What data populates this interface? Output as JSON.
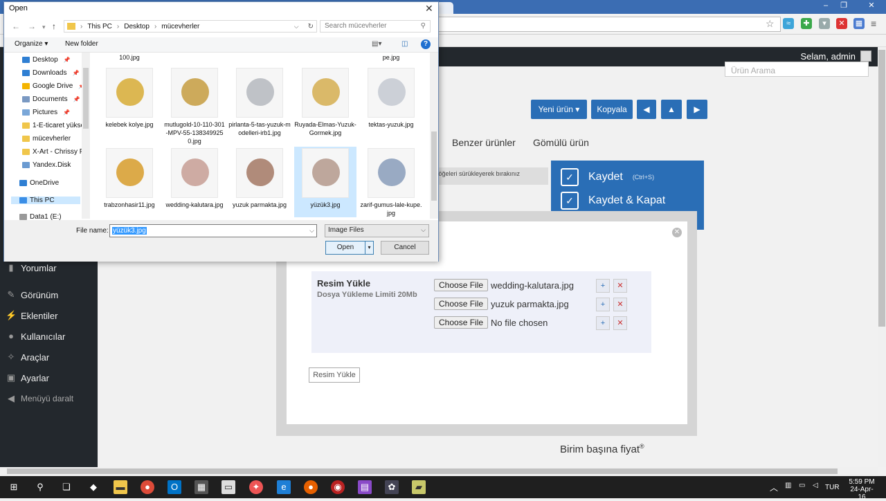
{
  "browser": {
    "minimize": "–",
    "restore": "❐",
    "close": "✕"
  },
  "wp": {
    "greeting": "Selam, admin",
    "search_placeholder": "Ürün Arama",
    "sidebar": [
      {
        "label": "Yorumlar",
        "icon": "comment-icon"
      },
      {
        "label": "Görünüm",
        "icon": "brush-icon"
      },
      {
        "label": "Eklentiler",
        "icon": "plugin-icon"
      },
      {
        "label": "Kullanıcılar",
        "icon": "user-icon"
      },
      {
        "label": "Araçlar",
        "icon": "wrench-icon"
      },
      {
        "label": "Ayarlar",
        "icon": "settings-icon"
      },
      {
        "label": "Menüyü daralt",
        "icon": "collapse-icon"
      }
    ],
    "buttons": {
      "new_product": "Yeni ürün",
      "copy": "Kopyala"
    },
    "tabs": [
      "Benzer ürünler",
      "Gömülü ürün"
    ],
    "hint": "n öğeleri sürükleyerek bırakınız",
    "save": "Kaydet",
    "save_shortcut": "(Ctrl+S)",
    "save_close": "Kaydet & Kapat",
    "unit_price": "Birim başına fiyat"
  },
  "modal": {
    "title": "Resim Yükle",
    "limit": "Dosya Yükleme Limiti 20Mb",
    "choose_label": "Choose File",
    "files": [
      "wedding-kalutara.jpg",
      "yuzuk parmakta.jpg",
      "No file chosen"
    ],
    "upload_button": "Resim Yükle"
  },
  "dialog": {
    "title": "Open",
    "breadcrumb": [
      "This PC",
      "Desktop",
      "mücevherler"
    ],
    "search_placeholder": "Search mücevherler",
    "organize": "Organize ▾",
    "new_folder": "New folder",
    "nav": [
      {
        "label": "Desktop",
        "color": "#2f7fd3",
        "pin": true
      },
      {
        "label": "Downloads",
        "color": "#2f7fd3",
        "pin": true
      },
      {
        "label": "Google Drive",
        "color": "#f4b400",
        "pin": true
      },
      {
        "label": "Documents",
        "color": "#7a99c2",
        "pin": true
      },
      {
        "label": "Pictures",
        "color": "#7aa7d8",
        "pin": true
      },
      {
        "label": "1-E-ticaret yükse",
        "color": "#f0c64b",
        "pin": false
      },
      {
        "label": "mücevherler",
        "color": "#f0c64b",
        "pin": false
      },
      {
        "label": "X-Art - Chrissy F",
        "color": "#f0c64b",
        "pin": false
      },
      {
        "label": "Yandex.Disk",
        "color": "#6b9bd1",
        "pin": false
      },
      {
        "label": "OneDrive",
        "color": "#2f7fd3",
        "pin": false
      },
      {
        "label": "This PC",
        "color": "#3a8ee6",
        "pin": false
      },
      {
        "label": "Data1 (E:)",
        "color": "#999999",
        "pin": false
      }
    ],
    "top_row": [
      "100.jpg",
      "pe.jpg"
    ],
    "files": [
      {
        "name": "kelebek kolye.jpg",
        "color": "#d9b040"
      },
      {
        "name": "mutlugold-10-110-301-MPV-55-1383499250.jpg",
        "color": "#c9a24a"
      },
      {
        "name": "pirlanta-5-tas-yuzuk-modelleri-irb1.jpg",
        "color": "#b9bcc2"
      },
      {
        "name": "Ruyada-Elmas-Yuzuk-Gormek.jpg",
        "color": "#d7b35a"
      },
      {
        "name": "tektas-yuzuk.jpg",
        "color": "#c8ccd4"
      },
      {
        "name": "trabzonhasir11.jpg",
        "color": "#d9a236"
      },
      {
        "name": "wedding-kalutara.jpg",
        "color": "#caa39a"
      },
      {
        "name": "yuzuk parmakta.jpg",
        "color": "#a9806d"
      },
      {
        "name": "yüzük3.jpg",
        "color": "#b89f92"
      },
      {
        "name": "zarif-gumus-lale-kupe.jpg",
        "color": "#8fa2be"
      }
    ],
    "file_name_label": "File name:",
    "file_name_value": "yüzük3.jpg",
    "file_type": "Image Files",
    "open": "Open",
    "cancel": "Cancel"
  },
  "taskbar": {
    "lang": "TUR",
    "time": "5:59 PM",
    "date": "24-Apr-16"
  }
}
